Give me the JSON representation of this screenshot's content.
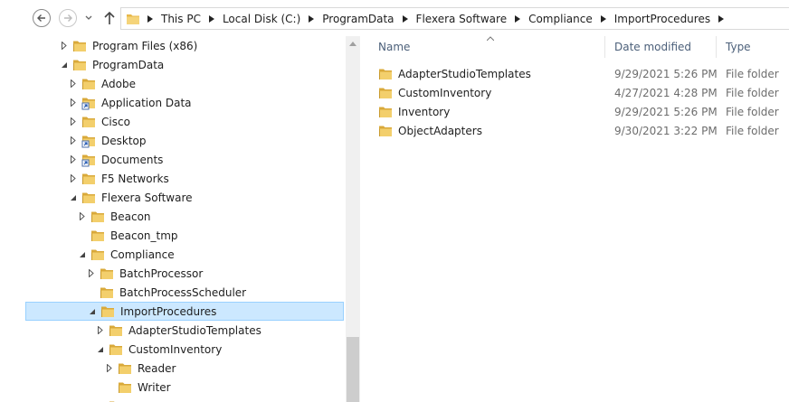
{
  "address": {
    "crumbs": [
      "This PC",
      "Local Disk (C:)",
      "ProgramData",
      "Flexera Software",
      "Compliance",
      "ImportProcedures"
    ]
  },
  "tree": {
    "items": [
      {
        "label": "Program Files (x86)",
        "indent": 0,
        "caret": "collapsed",
        "icon": "folder-icon"
      },
      {
        "label": "ProgramData",
        "indent": 0,
        "caret": "expanded",
        "icon": "folder-icon"
      },
      {
        "label": "Adobe",
        "indent": 1,
        "caret": "collapsed",
        "icon": "folder-icon"
      },
      {
        "label": "Application Data",
        "indent": 1,
        "caret": "collapsed",
        "icon": "folder-shortcut-icon"
      },
      {
        "label": "Cisco",
        "indent": 1,
        "caret": "collapsed",
        "icon": "folder-icon"
      },
      {
        "label": "Desktop",
        "indent": 1,
        "caret": "collapsed",
        "icon": "folder-shortcut-icon"
      },
      {
        "label": "Documents",
        "indent": 1,
        "caret": "collapsed",
        "icon": "folder-shortcut-icon"
      },
      {
        "label": "F5 Networks",
        "indent": 1,
        "caret": "collapsed",
        "icon": "folder-icon"
      },
      {
        "label": "Flexera Software",
        "indent": 1,
        "caret": "expanded",
        "icon": "folder-icon"
      },
      {
        "label": "Beacon",
        "indent": 2,
        "caret": "collapsed",
        "icon": "folder-icon"
      },
      {
        "label": "Beacon_tmp",
        "indent": 2,
        "caret": "none",
        "icon": "folder-icon"
      },
      {
        "label": "Compliance",
        "indent": 2,
        "caret": "expanded",
        "icon": "folder-icon"
      },
      {
        "label": "BatchProcessor",
        "indent": 3,
        "caret": "collapsed",
        "icon": "folder-icon"
      },
      {
        "label": "BatchProcessScheduler",
        "indent": 3,
        "caret": "none",
        "icon": "folder-icon"
      },
      {
        "label": "ImportProcedures",
        "indent": 3,
        "caret": "expanded",
        "icon": "folder-icon",
        "selected": true
      },
      {
        "label": "AdapterStudioTemplates",
        "indent": 4,
        "caret": "collapsed",
        "icon": "folder-icon"
      },
      {
        "label": "CustomInventory",
        "indent": 4,
        "caret": "expanded",
        "icon": "folder-icon"
      },
      {
        "label": "Reader",
        "indent": 5,
        "caret": "collapsed",
        "icon": "folder-icon"
      },
      {
        "label": "Writer",
        "indent": 5,
        "caret": "none",
        "icon": "folder-icon"
      },
      {
        "label": "",
        "indent": 4,
        "caret": "none",
        "icon": "folder-icon"
      }
    ]
  },
  "columns": {
    "name": "Name",
    "date": "Date modified",
    "type": "Type"
  },
  "files": [
    {
      "name": "AdapterStudioTemplates",
      "date": "9/29/2021 5:26 PM",
      "type": "File folder"
    },
    {
      "name": "CustomInventory",
      "date": "4/27/2021 4:28 PM",
      "type": "File folder"
    },
    {
      "name": "Inventory",
      "date": "9/29/2021 5:26 PM",
      "type": "File folder"
    },
    {
      "name": "ObjectAdapters",
      "date": "9/30/2021 3:22 PM",
      "type": "File folder"
    }
  ],
  "colors": {
    "selection_bg": "#cce8ff",
    "selection_border": "#99d1ff",
    "folder_yellow": "#e8b94a",
    "header_text": "#4c607a"
  }
}
